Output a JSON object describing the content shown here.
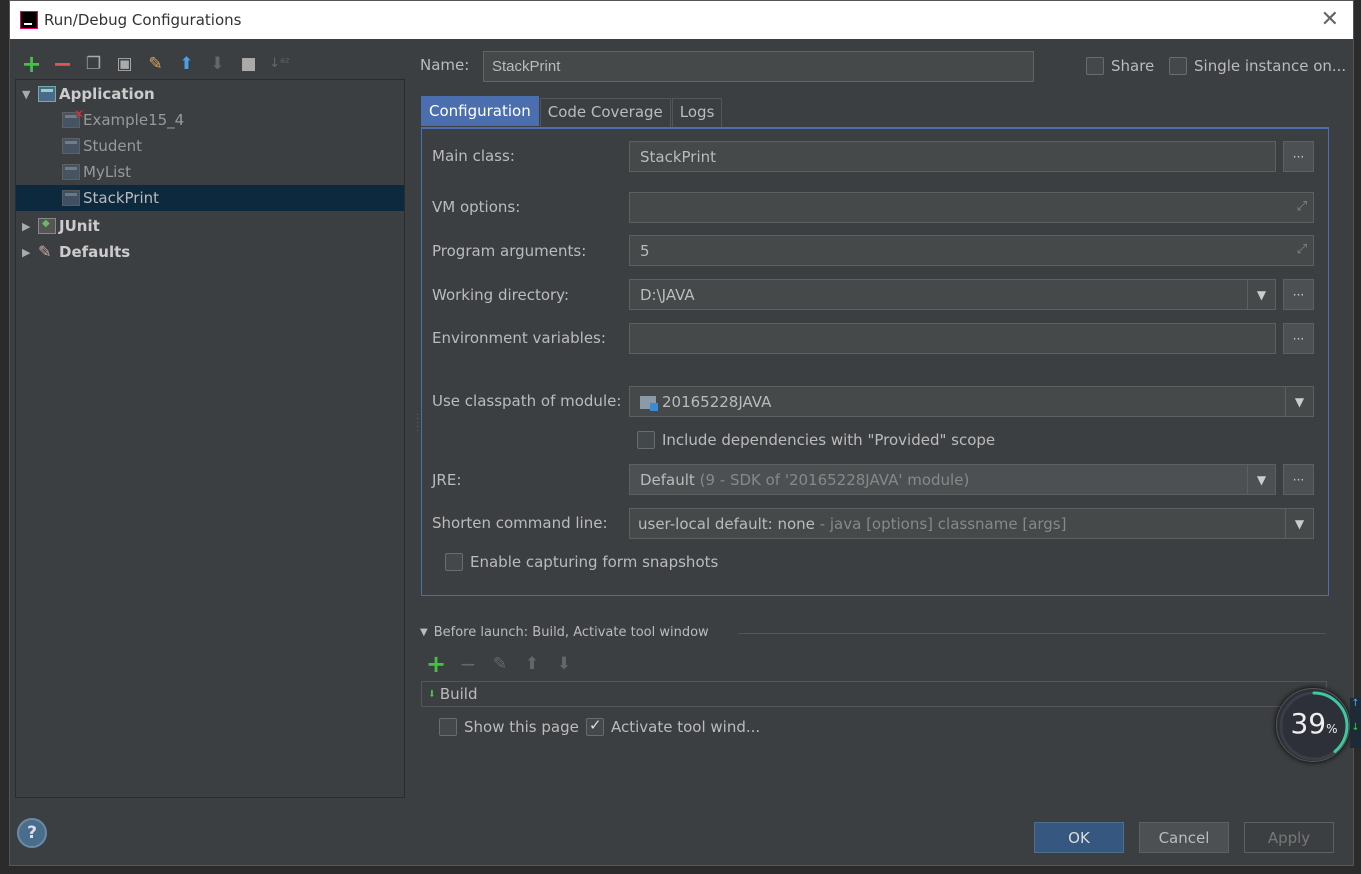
{
  "window": {
    "title": "Run/Debug Configurations"
  },
  "toolbar": {
    "icons": [
      "add-icon",
      "remove-icon",
      "copy-icon",
      "save-icon",
      "wrench-icon",
      "move-up-icon",
      "move-down-icon",
      "folder-icon",
      "sort-icon"
    ]
  },
  "tree": {
    "items": [
      {
        "label": "Application",
        "level": 0,
        "expanded": true,
        "bold": true
      },
      {
        "label": "Example15_4",
        "level": 1,
        "error": true
      },
      {
        "label": "Student",
        "level": 1
      },
      {
        "label": "MyList",
        "level": 1
      },
      {
        "label": "StackPrint",
        "level": 1,
        "selected": true
      },
      {
        "label": "JUnit",
        "level": 0,
        "expanded": false,
        "bold": true
      },
      {
        "label": "Defaults",
        "level": 0,
        "expanded": false,
        "bold": true
      }
    ]
  },
  "header": {
    "name_label": "Name:",
    "name_value": "StackPrint",
    "share_label": "Share",
    "share_checked": false,
    "single_instance_label": "Single instance on...",
    "single_instance_checked": false
  },
  "tabs": [
    {
      "label": "Configuration",
      "active": true
    },
    {
      "label": "Code Coverage",
      "active": false
    },
    {
      "label": "Logs",
      "active": false
    }
  ],
  "form": {
    "main_class_label": "Main class:",
    "main_class_value": "StackPrint",
    "vm_options_label": "VM options:",
    "vm_options_value": "",
    "program_args_label": "Program arguments:",
    "program_args_value": "5",
    "working_dir_label": "Working directory:",
    "working_dir_value": "D:\\JAVA",
    "env_vars_label": "Environment variables:",
    "env_vars_value": "",
    "classpath_label": "Use classpath of module:",
    "classpath_value": "20165228JAVA",
    "include_deps_label": "Include dependencies with \"Provided\" scope",
    "include_deps_checked": false,
    "jre_label": "JRE:",
    "jre_value": "Default",
    "jre_hint": "(9 - SDK of '20165228JAVA' module)",
    "shorten_label": "Shorten command line:",
    "shorten_value": "user-local default: none",
    "shorten_hint": "- java [options] classname [args]",
    "capture_label": "Enable capturing form snapshots",
    "capture_checked": false
  },
  "before_launch": {
    "title": "Before launch: Build, Activate tool window",
    "items": [
      "Build"
    ],
    "show_page_label": "Show this page",
    "show_page_checked": false,
    "activate_label": "Activate tool wind...",
    "activate_checked": true
  },
  "buttons": {
    "ok": "OK",
    "cancel": "Cancel",
    "apply": "Apply",
    "help": "?"
  },
  "gauge": {
    "value": "39",
    "unit": "%",
    "percent": 39
  },
  "colors": {
    "accent": "#4b6eaf",
    "selection": "#0d293e",
    "primary_button": "#365880"
  }
}
